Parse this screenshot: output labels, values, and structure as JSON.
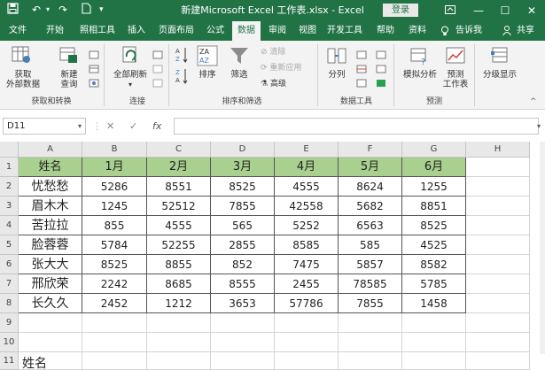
{
  "window": {
    "title": "新建Microsoft Excel 工作表.xlsx  -  Excel",
    "login_label": "登录",
    "ribbon_toggle_icon": "ribbon-display-icon",
    "minimize_icon": "minimize-icon",
    "maximize_icon": "maximize-icon",
    "close_icon": "close-icon",
    "quick_access": [
      "save-icon",
      "undo-icon",
      "redo-icon",
      "new-file-icon",
      "customize-icon"
    ]
  },
  "tabs": [
    {
      "label": "文件"
    },
    {
      "label": "开始"
    },
    {
      "label": "照相工具"
    },
    {
      "label": "插入"
    },
    {
      "label": "页面布局"
    },
    {
      "label": "公式"
    },
    {
      "label": "数据"
    },
    {
      "label": "审阅"
    },
    {
      "label": "视图"
    },
    {
      "label": "开发工具"
    },
    {
      "label": "帮助"
    },
    {
      "label": "资料"
    }
  ],
  "tell_me": "告诉我",
  "share": "共享",
  "ribbon": {
    "get_data_1": "获取",
    "get_data_2": "外部数据",
    "new_query_1": "新建",
    "new_query_2": "查询",
    "refresh_all": "全部刷新",
    "sort": "排序",
    "filter": "筛选",
    "clear": "清除",
    "reapply": "重新应用",
    "advanced": "高级",
    "split": "分列",
    "what_if_1": "模拟分析",
    "forecast_1": "预测",
    "forecast_2": "工作表",
    "outline": "分级显示",
    "group_get_transform": "获取和转换",
    "group_connections": "连接",
    "group_sort_filter": "排序和筛选",
    "group_data_tools": "数据工具",
    "group_forecast": "预测"
  },
  "formula_bar": {
    "name_box": "D11",
    "cancel": "✕",
    "enter": "✓",
    "fx": "fx"
  },
  "sheet": {
    "columns": [
      "A",
      "B",
      "C",
      "D",
      "E",
      "F",
      "G",
      "H"
    ],
    "rows": [
      "1",
      "2",
      "3",
      "4",
      "5",
      "6",
      "7",
      "8",
      "9",
      "10",
      "11"
    ],
    "header": [
      "姓名",
      "1月",
      "2月",
      "3月",
      "4月",
      "5月",
      "6月"
    ],
    "data": [
      [
        "忧愁愁",
        "5286",
        "8551",
        "8525",
        "4555",
        "8624",
        "1255"
      ],
      [
        "眉木木",
        "1245",
        "52512",
        "7855",
        "42558",
        "5682",
        "8851"
      ],
      [
        "苦拉拉",
        "855",
        "4555",
        "565",
        "5252",
        "6563",
        "8525"
      ],
      [
        "脸蓉蓉",
        "5784",
        "52255",
        "2855",
        "8585",
        "585",
        "4525"
      ],
      [
        "张大大",
        "8525",
        "8855",
        "852",
        "7475",
        "5857",
        "8582"
      ],
      [
        "邢欣荣",
        "2242",
        "8685",
        "8555",
        "2455",
        "78585",
        "5785"
      ],
      [
        "长久久",
        "2452",
        "1212",
        "3653",
        "57786",
        "7855",
        "1458"
      ]
    ],
    "row11_a": "姓名"
  }
}
